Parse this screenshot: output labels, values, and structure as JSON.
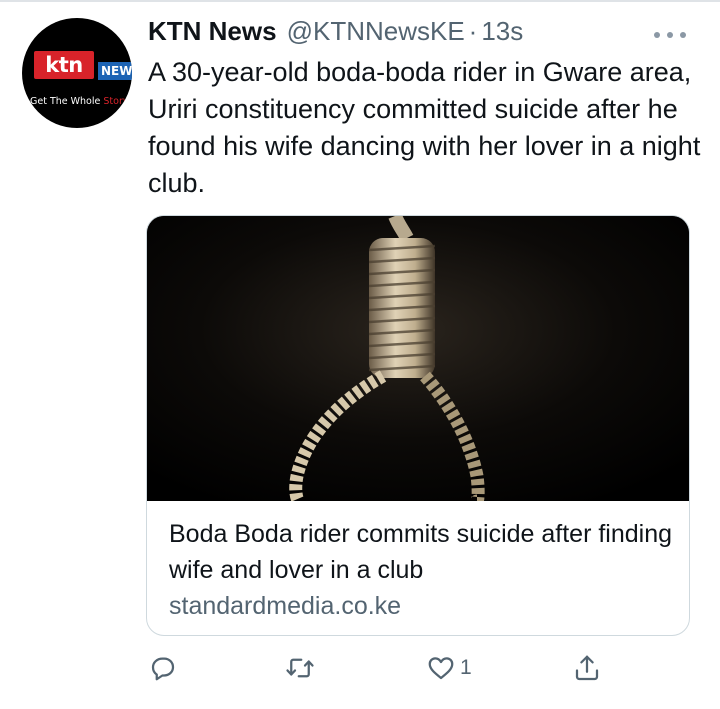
{
  "avatar": {
    "logo_text": "ktn",
    "news_text": "NEWS",
    "tagline_white": "Get The Whole ",
    "tagline_red": "Story"
  },
  "tweet": {
    "author_name": "KTN News",
    "handle": "@KTNNewsKE",
    "separator": "·",
    "time": "13s",
    "text": "A 30-year-old boda-boda rider in Gware area, Uriri constituency committed suicide after he found his wife dancing with her lover in a night club."
  },
  "card": {
    "title": "Boda Boda rider commits suicide after finding wife and lover in a club",
    "domain": "standardmedia.co.ke"
  },
  "actions": {
    "reply_icon": "reply-icon",
    "retweet_icon": "retweet-icon",
    "like_icon": "heart-icon",
    "like_count": "1",
    "share_icon": "share-icon"
  }
}
